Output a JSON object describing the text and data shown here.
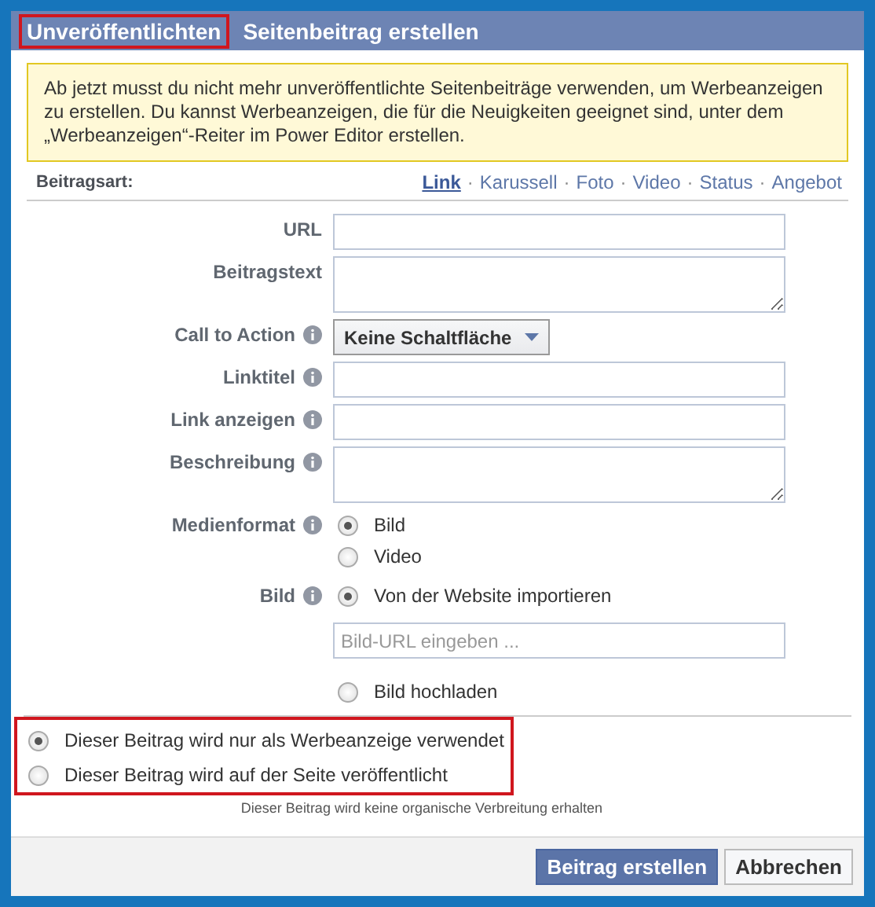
{
  "window": {
    "title_parts": [
      {
        "text": "Unveröffentlichten",
        "highlighted": true
      },
      {
        "text": "Seitenbeitrag erstellen",
        "highlighted": false
      }
    ]
  },
  "notice": "Ab jetzt musst du nicht mehr unveröffentlichte Seitenbeiträge verwenden, um Werbeanzeigen zu erstellen. Du kannst Werbeanzeigen, die für die Neuigkeiten geeignet sind, unter dem „Werbeanzeigen“-Reiter im Power Editor erstellen.",
  "post_type": {
    "label": "Beitragsart:",
    "types": [
      {
        "label": "Link",
        "selected": true
      },
      {
        "label": "Karussell",
        "selected": false
      },
      {
        "label": "Foto",
        "selected": false
      },
      {
        "label": "Video",
        "selected": false
      },
      {
        "label": "Status",
        "selected": false
      },
      {
        "label": "Angebot",
        "selected": false
      }
    ],
    "separator": "·"
  },
  "form": [
    {
      "kind": "text",
      "label": "URL",
      "info": false
    },
    {
      "kind": "textarea",
      "label": "Beitragstext",
      "info": false
    },
    {
      "kind": "select",
      "label": "Call to Action",
      "info": true,
      "value": "Keine Schaltfläche"
    },
    {
      "kind": "text",
      "label": "Linktitel",
      "info": true
    },
    {
      "kind": "text",
      "label": "Link anzeigen",
      "info": true
    },
    {
      "kind": "textarea",
      "label": "Beschreibung",
      "info": true
    },
    {
      "kind": "radio",
      "label": "Medienformat",
      "info": true,
      "options": [
        {
          "label": "Bild",
          "selected": true
        },
        {
          "label": "Video",
          "selected": false
        }
      ]
    },
    {
      "kind": "radio",
      "label": "Bild",
      "info": true,
      "options": [
        {
          "label": "Von der Website importieren",
          "selected": true,
          "placeholder": "Bild-URL eingeben ..."
        },
        {
          "label": "Bild hochladen",
          "selected": false
        }
      ]
    }
  ],
  "usage": {
    "highlighted": true,
    "options": [
      {
        "label": "Dieser Beitrag wird nur als Werbeanzeige verwendet",
        "selected": true
      },
      {
        "label": "Dieser Beitrag wird auf der Seite veröffentlicht",
        "selected": false
      }
    ],
    "note": "Dieser Beitrag wird keine organische Verbreitung erhalten"
  },
  "buttons": [
    {
      "label": "Beitrag erstellen",
      "kind": "primary"
    },
    {
      "label": "Abbrechen",
      "kind": "secondary"
    }
  ]
}
